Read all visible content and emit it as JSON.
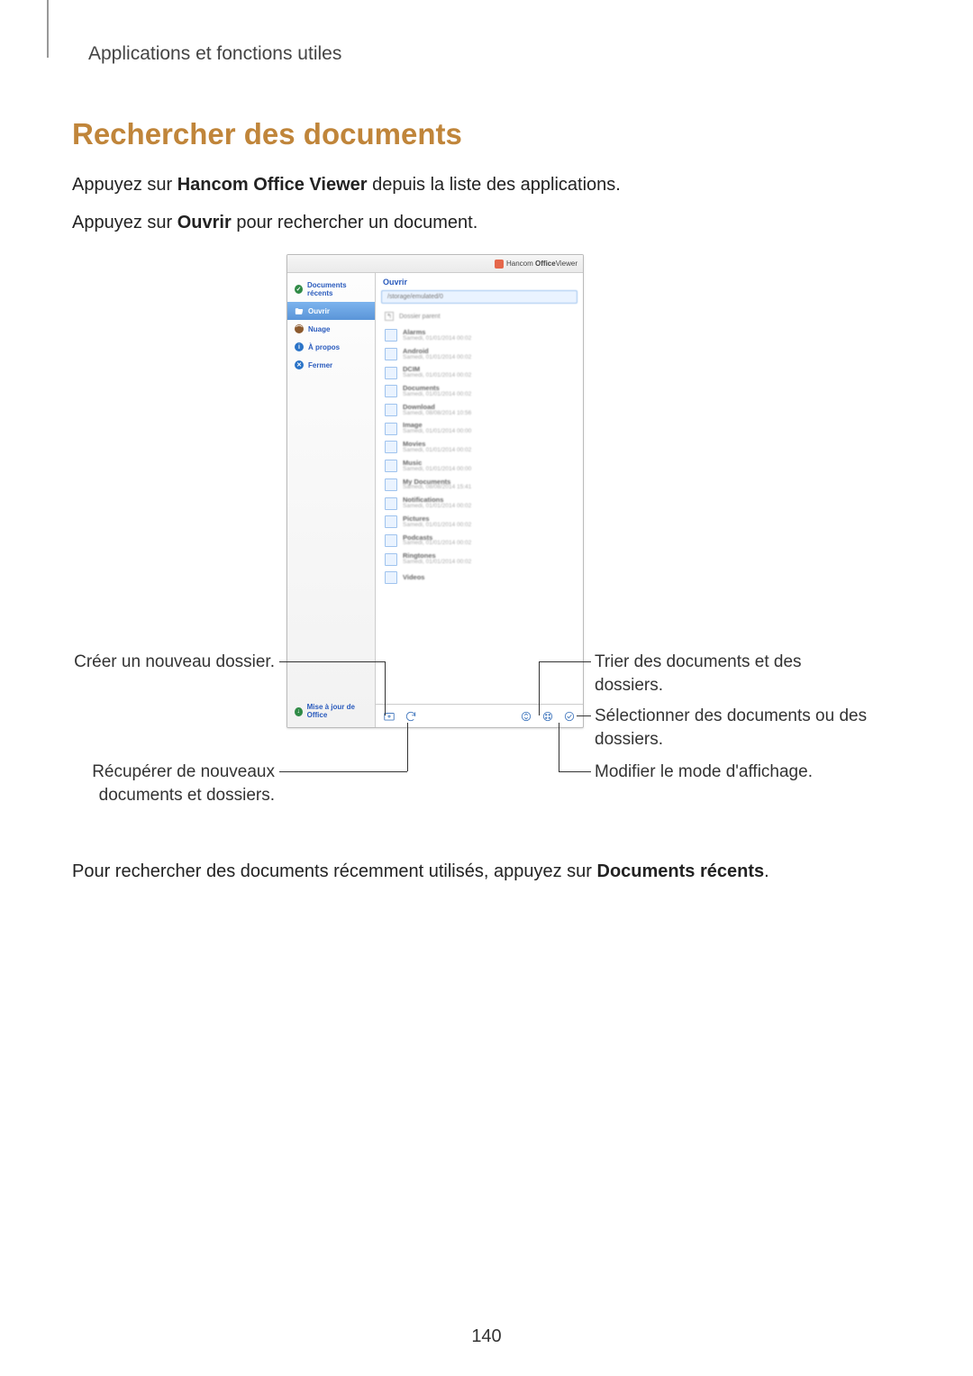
{
  "breadcrumb": "Applications et fonctions utiles",
  "title": "Rechercher des documents",
  "para1_pre": "Appuyez sur ",
  "para1_bold": "Hancom Office Viewer",
  "para1_post": " depuis la liste des applications.",
  "para2_pre": "Appuyez sur ",
  "para2_bold": "Ouvrir",
  "para2_post": " pour rechercher un document.",
  "para3_pre": "Pour rechercher des documents récemment utilisés, appuyez sur ",
  "para3_bold": "Documents récents",
  "para3_post": ".",
  "page_number": "140",
  "device": {
    "header_brand_pre": "Hancom ",
    "header_brand_bold": "Office",
    "header_brand_post": "Viewer",
    "sidebar": {
      "recents": "Documents récents",
      "open": "Ouvrir",
      "cloud": "Nuage",
      "about": "À propos",
      "close": "Fermer",
      "update": "Mise à jour de Office"
    },
    "main": {
      "title": "Ouvrir",
      "path": "/storage/emulated/0",
      "parent": "Dossier parent",
      "folders": [
        {
          "name": "Alarms",
          "date": "Samedi, 01/01/2014 00:02"
        },
        {
          "name": "Android",
          "date": "Samedi, 01/01/2014 00:02"
        },
        {
          "name": "DCIM",
          "date": "Samedi, 01/01/2014 00:02"
        },
        {
          "name": "Documents",
          "date": "Samedi, 01/01/2014 00:02"
        },
        {
          "name": "Download",
          "date": "Samedi, 08/08/2014 10:56"
        },
        {
          "name": "Image",
          "date": "Samedi, 01/01/2014 00:00"
        },
        {
          "name": "Movies",
          "date": "Samedi, 01/01/2014 00:02"
        },
        {
          "name": "Music",
          "date": "Samedi, 01/01/2014 00:00"
        },
        {
          "name": "My Documents",
          "date": "Samedi, 08/08/2014 15:41"
        },
        {
          "name": "Notifications",
          "date": "Samedi, 01/01/2014 00:02"
        },
        {
          "name": "Pictures",
          "date": "Samedi, 01/01/2014 00:02"
        },
        {
          "name": "Podcasts",
          "date": "Samedi, 01/01/2014 00:02"
        },
        {
          "name": "Ringtones",
          "date": "Samedi, 01/01/2014 00:02"
        },
        {
          "name": "Videos",
          "date": ""
        }
      ]
    }
  },
  "callouts": {
    "create_folder": "Créer un nouveau dossier.",
    "refresh": "Récupérer de nouveaux documents et dossiers.",
    "sort": "Trier des documents et des dossiers.",
    "select": "Sélectionner des documents ou des dossiers.",
    "view_mode": "Modifier le mode d'affichage."
  }
}
